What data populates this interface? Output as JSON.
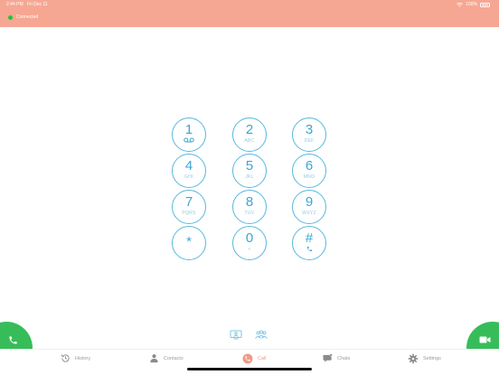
{
  "status_bar": {
    "time": "2:44 PM",
    "date": "Fri Dec 11",
    "battery": "100%"
  },
  "connection": {
    "status": "Connected"
  },
  "keypad": {
    "keys": [
      {
        "digit": "1",
        "letters": "",
        "sub_icon": "voicemail-icon"
      },
      {
        "digit": "2",
        "letters": "ABC"
      },
      {
        "digit": "3",
        "letters": "DEF"
      },
      {
        "digit": "4",
        "letters": "GHI"
      },
      {
        "digit": "5",
        "letters": "JKL"
      },
      {
        "digit": "6",
        "letters": "MNO"
      },
      {
        "digit": "7",
        "letters": "PQRS"
      },
      {
        "digit": "8",
        "letters": "TUV"
      },
      {
        "digit": "9",
        "letters": "WXYZ"
      },
      {
        "digit": "*",
        "letters": ""
      },
      {
        "digit": "0",
        "letters": "+"
      },
      {
        "digit": "#",
        "letters": "",
        "sub_icon": "phone-small-icon"
      }
    ]
  },
  "tabs": [
    {
      "label": "History",
      "icon": "history-icon"
    },
    {
      "label": "Contacts",
      "icon": "contacts-icon"
    },
    {
      "label": "Call",
      "icon": "call-icon",
      "active": true
    },
    {
      "label": "Chats",
      "icon": "chats-icon"
    },
    {
      "label": "Settings",
      "icon": "settings-icon"
    }
  ],
  "colors": {
    "header": "#f6a793",
    "accent": "#f29a86",
    "keypad": "#58b8de",
    "call_green": "#36bd59",
    "connected": "#21c33a"
  }
}
